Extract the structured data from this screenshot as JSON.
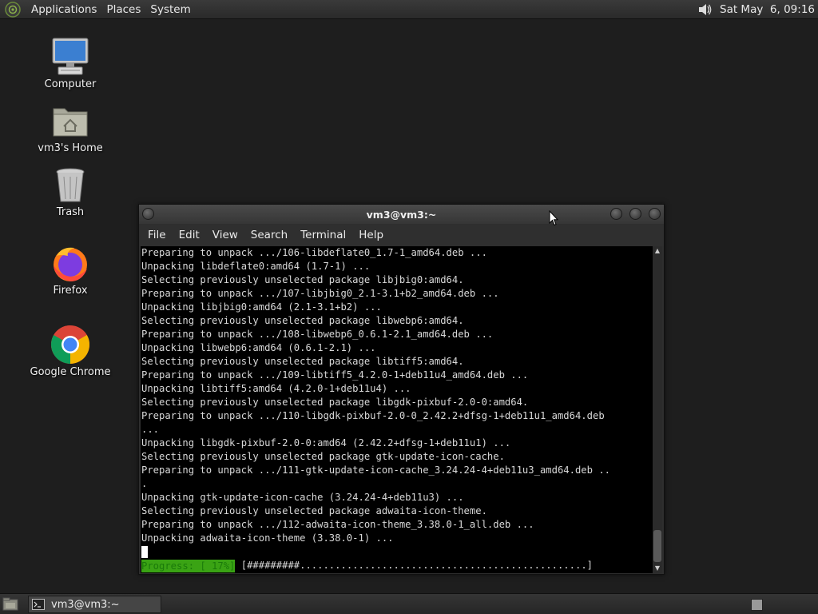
{
  "top_panel": {
    "menus": [
      "Applications",
      "Places",
      "System"
    ],
    "clock": "Sat May  6, 09:16",
    "logo_icon": "distro-logo-icon",
    "volume_icon": "speaker-icon"
  },
  "desktop_icons": [
    {
      "label": "Computer",
      "icon": "computer-icon"
    },
    {
      "label": "vm3's Home",
      "icon": "home-folder-icon"
    },
    {
      "label": "Trash",
      "icon": "trash-icon"
    },
    {
      "label": "Firefox",
      "icon": "firefox-icon"
    },
    {
      "label": "Google Chrome",
      "icon": "chrome-icon"
    }
  ],
  "terminal": {
    "title": "vm3@vm3:~",
    "menu": [
      "File",
      "Edit",
      "View",
      "Search",
      "Terminal",
      "Help"
    ],
    "lines": [
      "Preparing to unpack .../106-libdeflate0_1.7-1_amd64.deb ...",
      "Unpacking libdeflate0:amd64 (1.7-1) ...",
      "Selecting previously unselected package libjbig0:amd64.",
      "Preparing to unpack .../107-libjbig0_2.1-3.1+b2_amd64.deb ...",
      "Unpacking libjbig0:amd64 (2.1-3.1+b2) ...",
      "Selecting previously unselected package libwebp6:amd64.",
      "Preparing to unpack .../108-libwebp6_0.6.1-2.1_amd64.deb ...",
      "Unpacking libwebp6:amd64 (0.6.1-2.1) ...",
      "Selecting previously unselected package libtiff5:amd64.",
      "Preparing to unpack .../109-libtiff5_4.2.0-1+deb11u4_amd64.deb ...",
      "Unpacking libtiff5:amd64 (4.2.0-1+deb11u4) ...",
      "Selecting previously unselected package libgdk-pixbuf-2.0-0:amd64.",
      "Preparing to unpack .../110-libgdk-pixbuf-2.0-0_2.42.2+dfsg-1+deb11u1_amd64.deb",
      "...",
      "Unpacking libgdk-pixbuf-2.0-0:amd64 (2.42.2+dfsg-1+deb11u1) ...",
      "Selecting previously unselected package gtk-update-icon-cache.",
      "Preparing to unpack .../111-gtk-update-icon-cache_3.24.24-4+deb11u3_amd64.deb ..",
      ".",
      "Unpacking gtk-update-icon-cache (3.24.24-4+deb11u3) ...",
      "Selecting previously unselected package adwaita-icon-theme.",
      "Preparing to unpack .../112-adwaita-icon-theme_3.38.0-1_all.deb ...",
      "Unpacking adwaita-icon-theme (3.38.0-1) ..."
    ],
    "progress_label": "Progress: [ 17%]",
    "progress_bar": " [#########.................................................] ",
    "progress_percent": 17
  },
  "taskbar": {
    "window_title": "vm3@vm3:~",
    "show_desktop_icon": "show-desktop-icon",
    "terminal_icon": "terminal-icon"
  }
}
